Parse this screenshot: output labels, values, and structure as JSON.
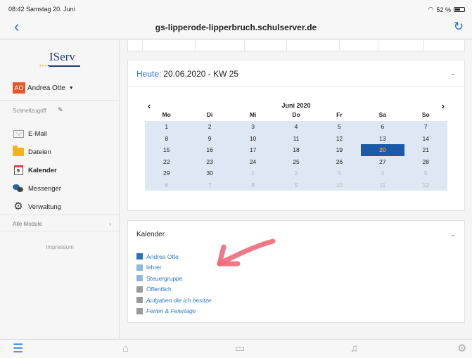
{
  "status": {
    "time": "08:42",
    "date": "Samstag 20. Juni",
    "battery": "52 %"
  },
  "nav": {
    "back": "‹",
    "title": "gs-lipperode-lipperbruch.schulserver.de"
  },
  "sidebar": {
    "logo": "IServ",
    "user": {
      "initials": "AO",
      "name": "Andrea Otte"
    },
    "quick_access": "Schnellzugriff",
    "items": [
      {
        "label": "E-Mail",
        "icon": "mail-icon"
      },
      {
        "label": "Dateien",
        "icon": "folder-icon"
      },
      {
        "label": "Kalender",
        "icon": "calendar-icon",
        "calendar_glyph": "9"
      },
      {
        "label": "Messenger",
        "icon": "chat-icon"
      },
      {
        "label": "Verwaltung",
        "icon": "gear-icon"
      }
    ],
    "all_modules": "Alle Module",
    "impressum": "Impressum"
  },
  "calendar": {
    "heading_prefix": "Heute:",
    "heading_value": "20.06.2020 - KW 25",
    "month_label": "Juni 2020",
    "weekdays": [
      "Mo",
      "Di",
      "Mi",
      "Do",
      "Fr",
      "Sa",
      "So"
    ],
    "weeks": [
      [
        "1",
        "2",
        "3",
        "4",
        "5",
        "6",
        "7"
      ],
      [
        "8",
        "9",
        "10",
        "11",
        "12",
        "13",
        "14"
      ],
      [
        "15",
        "16",
        "17",
        "18",
        "19",
        "20",
        "21"
      ],
      [
        "22",
        "23",
        "24",
        "25",
        "26",
        "27",
        "28"
      ],
      [
        "29",
        "30",
        "1",
        "2",
        "3",
        "4",
        "5"
      ],
      [
        "6",
        "7",
        "8",
        "9",
        "10",
        "11",
        "12"
      ]
    ],
    "today": "20"
  },
  "calendar_list": {
    "title": "Kalender",
    "items": [
      {
        "label": "Andrea Otte",
        "color": "#2f6fc2"
      },
      {
        "label": "lehrer",
        "color": "#8fb8e0"
      },
      {
        "label": "Steuergruppe",
        "color": "#8fb8e0"
      },
      {
        "label": "Öffentlich",
        "color": "#9a9a9a"
      },
      {
        "label": "Aufgaben die ich besitze",
        "color": "#9a9a9a"
      },
      {
        "label": "Ferien & Feiertage",
        "color": "#9a9a9a"
      }
    ]
  },
  "colors": {
    "accent": "#1e6fd9",
    "today_bg": "#1a5aa8",
    "today_fg": "#f7a12b",
    "annotation": "#f06a7a"
  }
}
